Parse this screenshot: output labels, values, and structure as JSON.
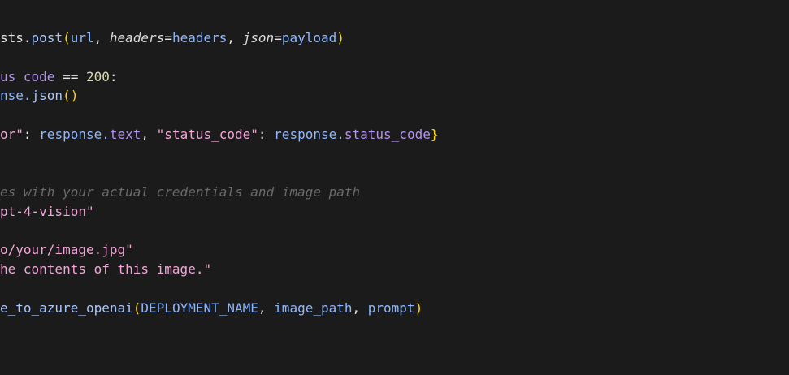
{
  "lines": [
    {
      "tokens": [
        {
          "t": "sts.",
          "c": "white"
        },
        {
          "t": "post",
          "c": "method"
        },
        {
          "t": "(",
          "c": "paren"
        },
        {
          "t": "url",
          "c": "ident"
        },
        {
          "t": ", ",
          "c": "white"
        },
        {
          "t": "headers",
          "c": "param"
        },
        {
          "t": "=",
          "c": "white"
        },
        {
          "t": "headers",
          "c": "ident"
        },
        {
          "t": ", ",
          "c": "white"
        },
        {
          "t": "json",
          "c": "param"
        },
        {
          "t": "=",
          "c": "white"
        },
        {
          "t": "payload",
          "c": "ident"
        },
        {
          "t": ")",
          "c": "paren"
        }
      ]
    },
    {
      "tokens": [
        {
          "t": "us_code",
          "c": "attr"
        },
        {
          "t": " == ",
          "c": "white"
        },
        {
          "t": "200",
          "c": "num"
        },
        {
          "t": ":",
          "c": "white"
        }
      ]
    },
    {
      "tokens": [
        {
          "t": "nse.",
          "c": "ident"
        },
        {
          "t": "json",
          "c": "method"
        },
        {
          "t": "()",
          "c": "paren"
        }
      ]
    },
    {
      "tokens": [
        {
          "t": "or\"",
          "c": "str"
        },
        {
          "t": ": ",
          "c": "white"
        },
        {
          "t": "response.",
          "c": "ident"
        },
        {
          "t": "text",
          "c": "attr"
        },
        {
          "t": ", ",
          "c": "white"
        },
        {
          "t": "\"status_code\"",
          "c": "str"
        },
        {
          "t": ": ",
          "c": "white"
        },
        {
          "t": "response.",
          "c": "ident"
        },
        {
          "t": "status_code",
          "c": "attr"
        },
        {
          "t": "}",
          "c": "paren"
        }
      ]
    },
    {
      "tokens": [
        {
          "t": "es with your actual credentials and image path",
          "c": "comment"
        }
      ]
    },
    {
      "tokens": [
        {
          "t": "pt-4-vision\"",
          "c": "str"
        }
      ]
    },
    {
      "tokens": [
        {
          "t": "o/your/image.jpg\"",
          "c": "str"
        }
      ]
    },
    {
      "tokens": [
        {
          "t": "he contents of this image.\"",
          "c": "str"
        }
      ]
    },
    {
      "tokens": [
        {
          "t": "e_to_azure_openai",
          "c": "method"
        },
        {
          "t": "(",
          "c": "paren"
        },
        {
          "t": "DEPLOYMENT_NAME",
          "c": "const"
        },
        {
          "t": ", ",
          "c": "white"
        },
        {
          "t": "image_path",
          "c": "ident"
        },
        {
          "t": ", ",
          "c": "white"
        },
        {
          "t": "prompt",
          "c": "ident"
        },
        {
          "t": ")",
          "c": "paren"
        }
      ]
    }
  ]
}
